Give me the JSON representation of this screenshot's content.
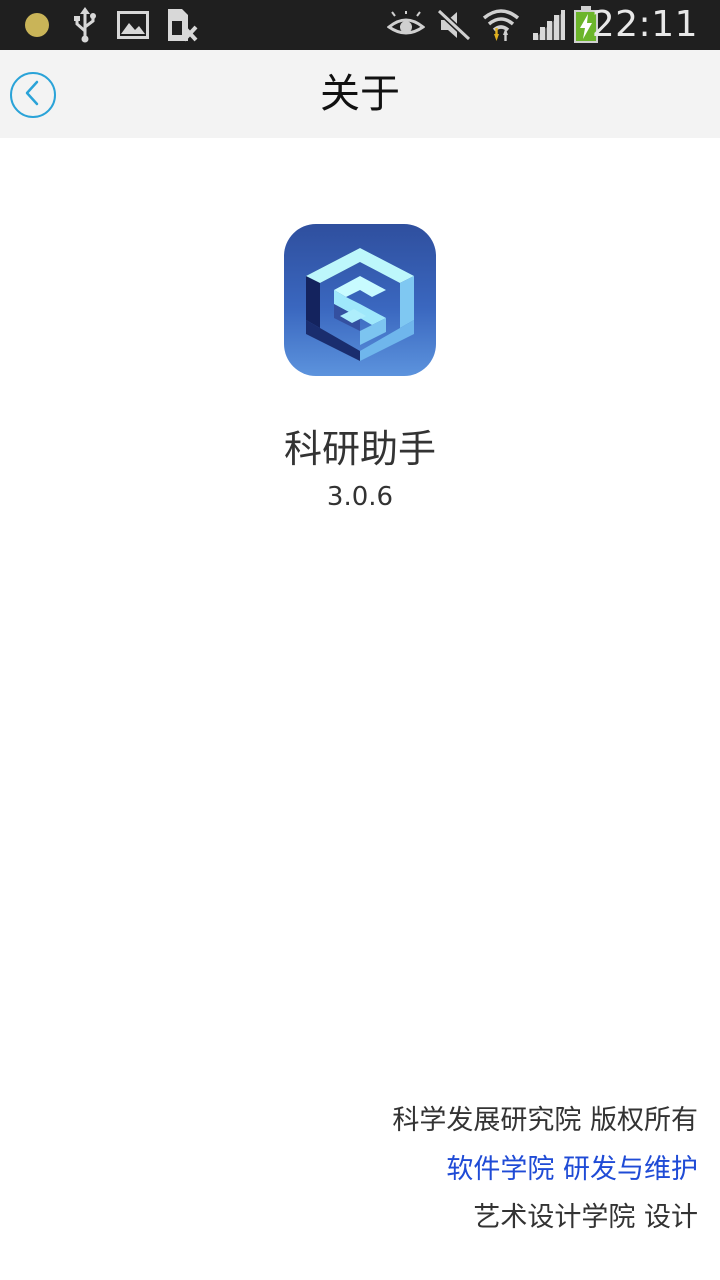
{
  "status_bar": {
    "time": "22:11",
    "icons": [
      "notification-dot-icon",
      "usb-icon",
      "image-icon",
      "sim-card-x-icon",
      "eye-icon",
      "muted-icon",
      "wifi-icon",
      "signal-icon",
      "battery-charging-icon"
    ]
  },
  "header": {
    "title": "关于",
    "back_icon": "chevron-left-icon"
  },
  "app": {
    "name": "科研助手",
    "version": "3.0.6",
    "icon": "app-logo-icon"
  },
  "footer": {
    "copyright": "科学发展研究院 版权所有",
    "maintenance": "软件学院 研发与维护",
    "design": "艺术设计学院 设计"
  },
  "colors": {
    "status_bar_bg": "#1f1f1f",
    "title_bar_bg": "#f3f3f3",
    "back_accent": "#2aa3d8",
    "link_blue": "#1f4bd6",
    "text_dark": "#333333"
  }
}
